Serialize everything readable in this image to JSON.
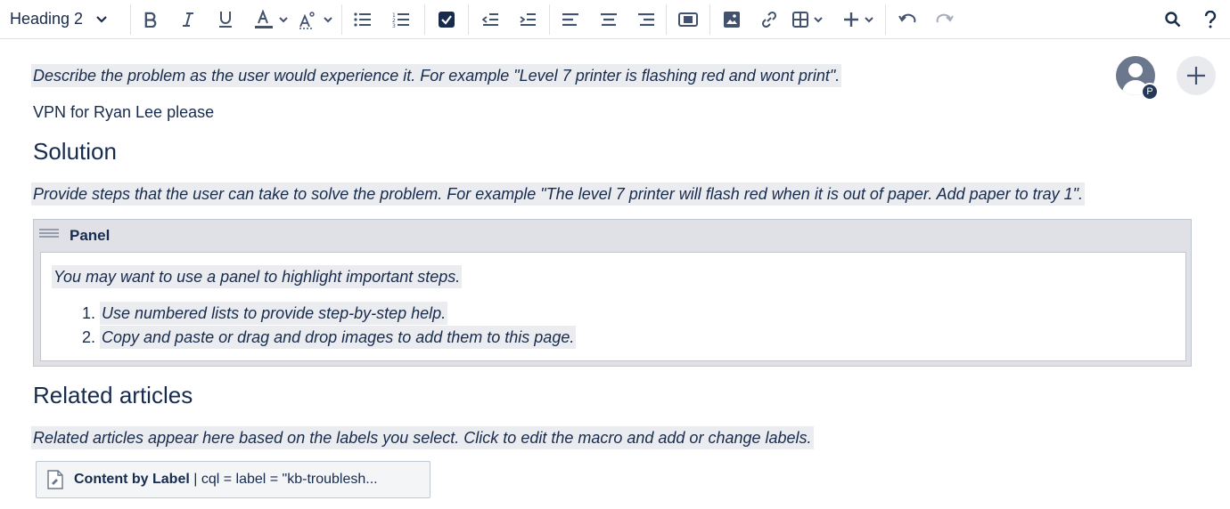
{
  "toolbar": {
    "text_style": "Heading 2",
    "icons": {
      "bold": "bold-icon",
      "italic": "italic-icon",
      "underline": "underline-icon",
      "text_color": "text-color-icon",
      "clear_format": "clear-formatting-icon",
      "bullet_list": "bullet-list-icon",
      "numbered_list": "numbered-list-icon",
      "task_list": "task-list-icon",
      "outdent": "outdent-icon",
      "indent": "indent-icon",
      "align_left": "align-left-icon",
      "align_center": "align-center-icon",
      "align_right": "align-right-icon",
      "page_layout": "page-layout-icon",
      "image": "image-icon",
      "link": "link-icon",
      "table": "table-icon",
      "insert": "plus-icon",
      "undo": "undo-icon",
      "redo": "redo-icon",
      "search": "search-icon",
      "help": "help-icon"
    }
  },
  "collaborators": {
    "avatar_badge": "P"
  },
  "content": {
    "problem_instructions": "Describe the problem as the user would experience it. For example \"Level 7 printer is flashing red and wont print\".",
    "problem_text": "VPN for Ryan Lee please",
    "solution_heading": "Solution",
    "solution_instructions": "Provide steps that the user can take to solve the problem. For example \"The level 7 printer will flash red when it is out of paper. Add paper to tray 1\".",
    "panel": {
      "title": "Panel",
      "intro": "You may want to use a panel to highlight important steps.",
      "steps": [
        {
          "num": "1.",
          "text": "Use numbered lists to provide step-by-step help."
        },
        {
          "num": "2.",
          "text": "Copy and paste or drag and drop images to add them to this page."
        }
      ]
    },
    "related_heading": "Related articles",
    "related_instructions": "Related articles appear here based on the labels you select. Click to edit the macro and add or change labels.",
    "macro": {
      "name": "Content by Label",
      "params": " | cql = label = \"kb-troublesh..."
    }
  },
  "colors": {
    "accent": "#42526e",
    "instruction_bg": "#ebecf0",
    "panel_bg": "#dfe1e6"
  }
}
